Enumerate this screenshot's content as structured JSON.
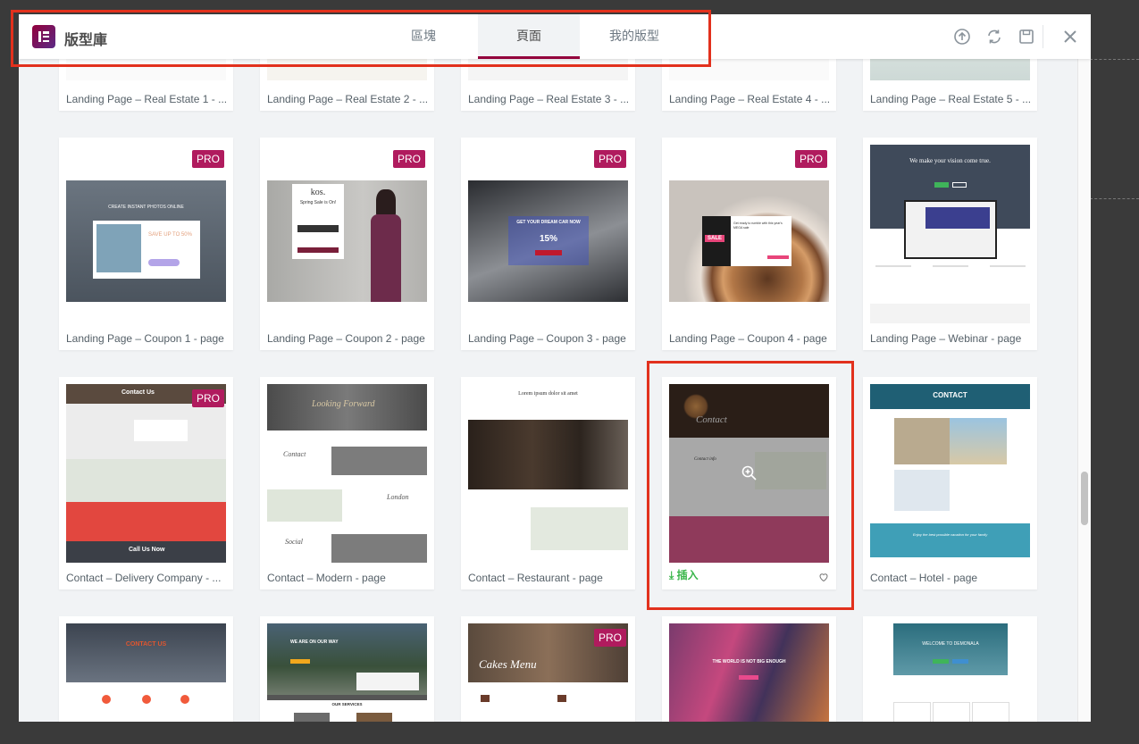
{
  "app": {
    "title": "版型庫"
  },
  "tabs": [
    {
      "label": "區塊",
      "active": false
    },
    {
      "label": "頁面",
      "active": true
    },
    {
      "label": "我的版型",
      "active": false
    }
  ],
  "header_icons": [
    "upload-icon",
    "sync-icon",
    "save-icon",
    "close-icon"
  ],
  "badge_text": "PRO",
  "insert_label": "插入",
  "colors": {
    "accent": "#93003c",
    "pro": "#b01b5e",
    "insert": "#39b54a",
    "highlight": "#e2311d"
  },
  "rows": [
    {
      "items": [
        {
          "title": "Landing Page – Real Estate 1 - ...",
          "pro": false
        },
        {
          "title": "Landing Page – Real Estate 2 - ...",
          "pro": false
        },
        {
          "title": "Landing Page – Real Estate 3 - ...",
          "pro": false
        },
        {
          "title": "Landing Page – Real Estate 4 - ...",
          "pro": false
        },
        {
          "title": "Landing Page – Real Estate 5 - ...",
          "pro": false
        }
      ]
    },
    {
      "items": [
        {
          "title": "Landing Page – Coupon 1 - page",
          "pro": true,
          "preview_texts": [
            "CREATE INSTANT PHOTOS ONLINE",
            "SAVE UP TO 50%"
          ]
        },
        {
          "title": "Landing Page – Coupon 2 - page",
          "pro": true,
          "preview_texts": [
            "kos.",
            "Spring Sale is On!"
          ]
        },
        {
          "title": "Landing Page – Coupon 3 - page",
          "pro": true,
          "preview_texts": [
            "GET YOUR DREAM CAR NOW",
            "15%"
          ]
        },
        {
          "title": "Landing Page – Coupon 4 - page",
          "pro": true,
          "preview_texts": [
            "SALE",
            "Get ready to rumble with this year's MEGA sale"
          ]
        },
        {
          "title": "Landing Page – Webinar - page",
          "pro": false,
          "preview_texts": [
            "We make your vision come true."
          ]
        }
      ]
    },
    {
      "items": [
        {
          "title": "Contact – Delivery Company - ...",
          "pro": true,
          "preview_texts": [
            "Contact Us",
            "Call Us Now"
          ]
        },
        {
          "title": "Contact – Modern - page",
          "pro": false,
          "preview_texts": [
            "Looking Forward",
            "Contact",
            "London",
            "Social"
          ]
        },
        {
          "title": "Contact – Restaurant - page",
          "pro": false,
          "preview_texts": [
            "Lorem ipsum dolor sit amet"
          ]
        },
        {
          "title": "",
          "pro": false,
          "hovered": true,
          "preview_texts": [
            "Contact",
            "Contact info"
          ]
        },
        {
          "title": "Contact – Hotel - page",
          "pro": false,
          "preview_texts": [
            "CONTACT",
            "Enjoy the best possible vacation for your family"
          ]
        }
      ]
    },
    {
      "items": [
        {
          "title": "",
          "pro": false,
          "preview_texts": [
            "CONTACT US"
          ]
        },
        {
          "title": "",
          "pro": false,
          "preview_texts": [
            "WE ARE ON OUR WAY",
            "OUR SERVICES"
          ]
        },
        {
          "title": "",
          "pro": true,
          "preview_texts": [
            "Cakes Menu"
          ]
        },
        {
          "title": "",
          "pro": false,
          "preview_texts": [
            "THE WORLD IS NOT BIG ENOUGH"
          ]
        },
        {
          "title": "",
          "pro": false,
          "preview_texts": [
            "WELCOME TO DEMONALA"
          ]
        }
      ]
    }
  ]
}
